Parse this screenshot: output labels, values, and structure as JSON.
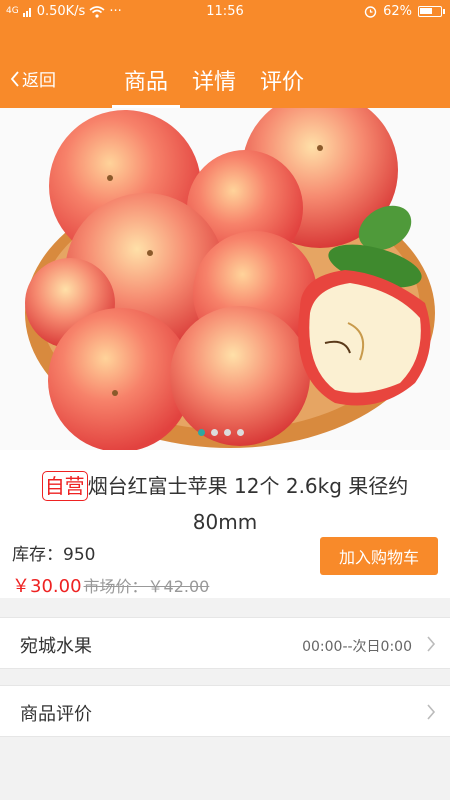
{
  "status_bar": {
    "signal_label": "4G",
    "speed": "0.50K/s",
    "wifi_icon": "wifi-icon",
    "more": "···",
    "time": "11:56",
    "alarm_icon": "alarm-icon",
    "battery_percent": "62%",
    "battery_level": 0.62
  },
  "nav": {
    "back_label": "返回",
    "tabs": [
      {
        "label": "商品",
        "active": true
      },
      {
        "label": "详情",
        "active": false
      },
      {
        "label": "评价",
        "active": false
      }
    ]
  },
  "carousel": {
    "image_icon": "apple-basket-image",
    "total_slides": 4,
    "active_slide": 1
  },
  "product": {
    "badge": "自营",
    "title": "烟台红富士苹果 12个 2.6kg 果径约80mm",
    "stock_label": "库存：950",
    "price": "￥30.00",
    "market_price": "市场价：￥42.00",
    "cart_button": "加入购物车"
  },
  "rows": [
    {
      "label": "宛城水果",
      "value": "00:00--次日0:00"
    },
    {
      "label": "商品评价",
      "value": ""
    }
  ],
  "colors": {
    "accent": "#f88a2a",
    "price": "#ee2222",
    "dot_active": "#2ea7a0"
  }
}
